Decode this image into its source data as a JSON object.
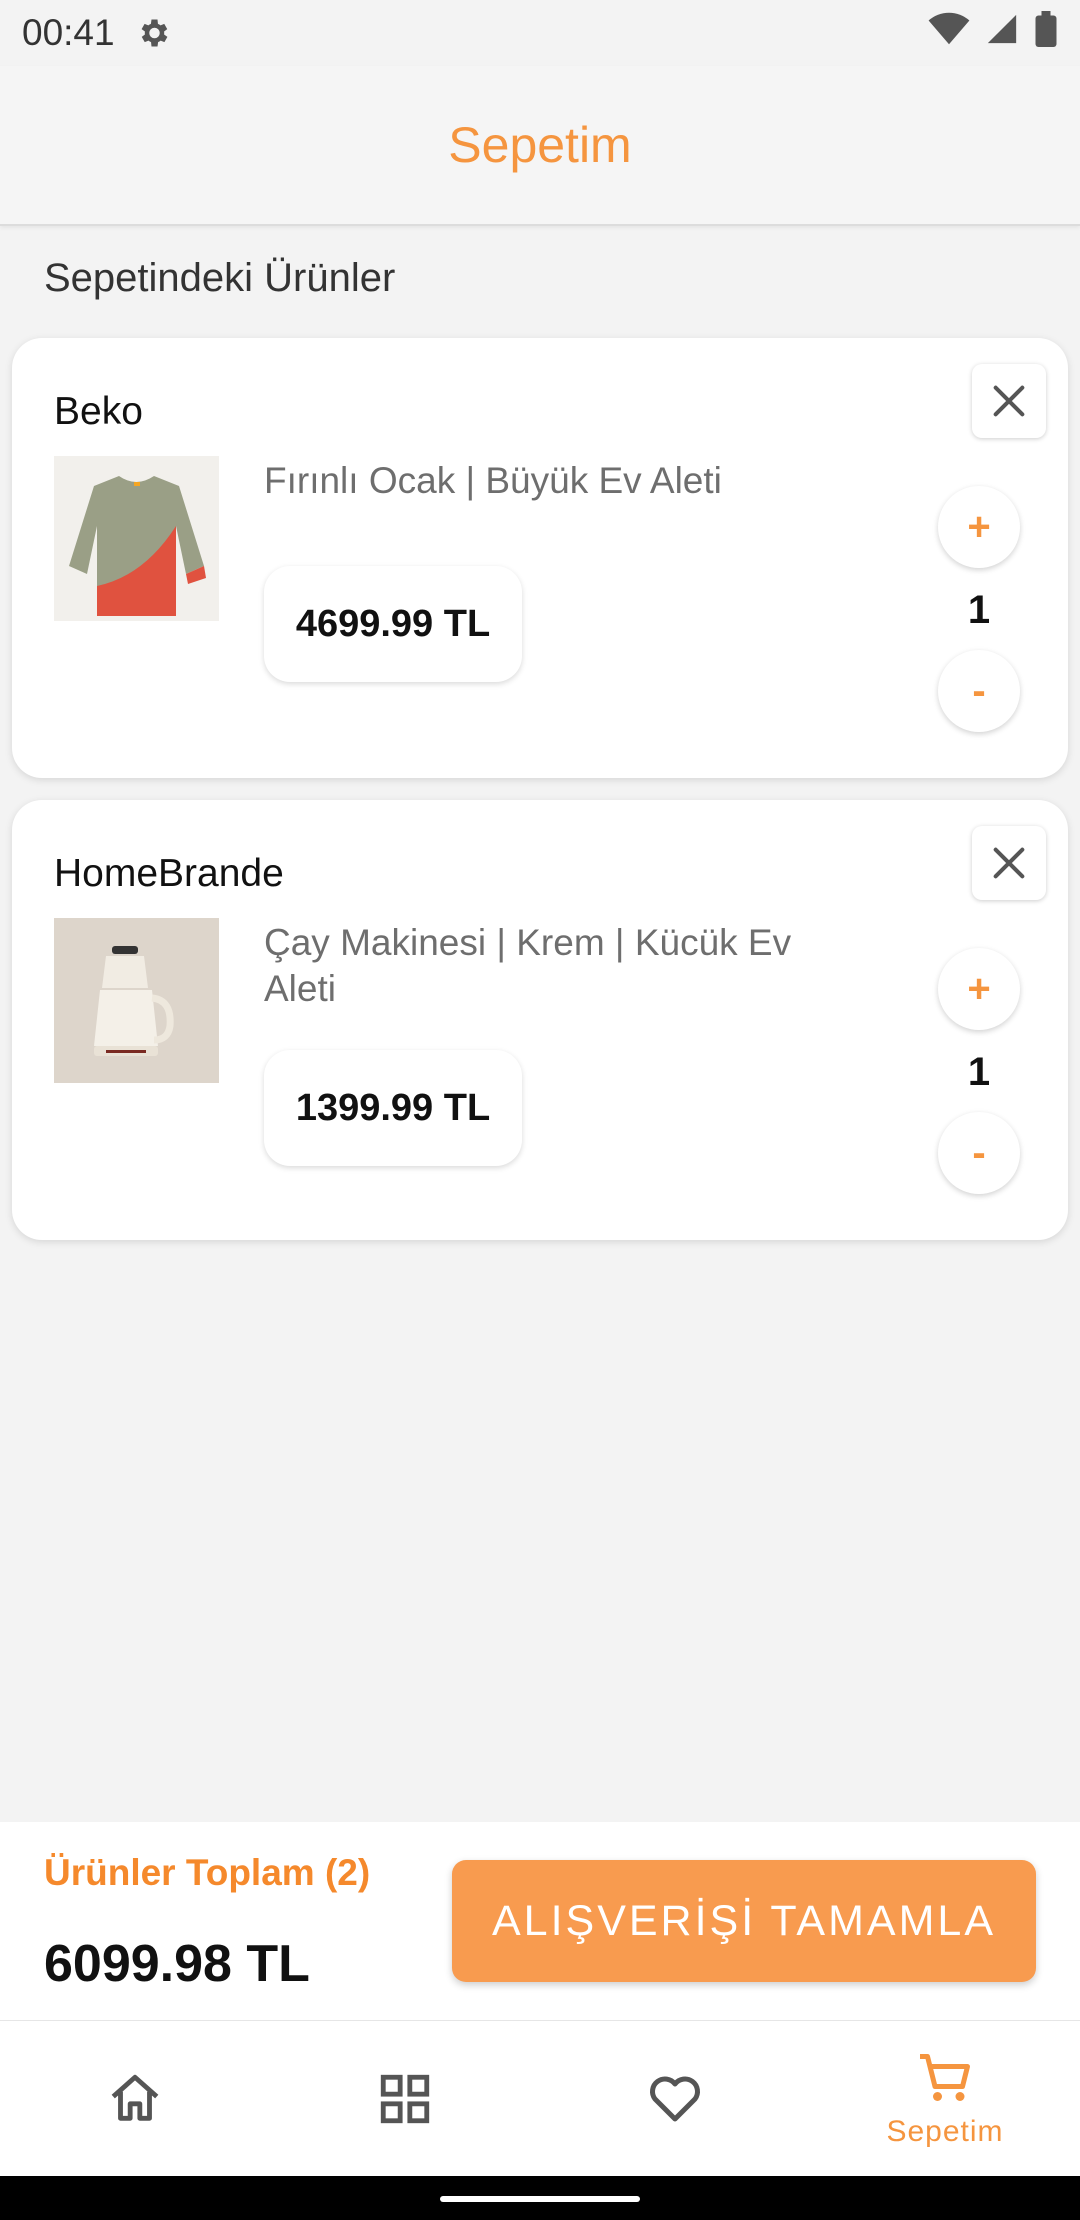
{
  "status_bar": {
    "time": "00:41",
    "icons": [
      "gear-icon",
      "wifi-icon",
      "signal-icon",
      "battery-icon"
    ]
  },
  "app_bar": {
    "title": "Sepetim"
  },
  "section": {
    "title": "Sepetindeki Ürünler"
  },
  "cart": {
    "items": [
      {
        "brand": "Beko",
        "name": "Fırınlı Ocak | Büyük  Ev Aleti",
        "price": "4699.99 TL",
        "quantity": "1",
        "plus": "+",
        "minus": "-"
      },
      {
        "brand": "HomeBrande",
        "name": "Çay Makinesi | Krem | Kücük Ev Aleti",
        "price": "1399.99 TL",
        "quantity": "1",
        "plus": "+",
        "minus": "-"
      }
    ]
  },
  "summary": {
    "label": "Ürünler Toplam (2)",
    "total": "6099.98 TL",
    "checkout_label": "ALIŞVERİŞİ TAMAMLA"
  },
  "bottom_nav": {
    "items": [
      {
        "icon": "home-icon",
        "label": ""
      },
      {
        "icon": "grid-icon",
        "label": ""
      },
      {
        "icon": "heart-icon",
        "label": ""
      },
      {
        "icon": "cart-icon",
        "label": "Sepetim",
        "active": true
      }
    ]
  },
  "colors": {
    "accent": "#f5953f",
    "button": "#f89b4f",
    "background": "#f3f3f3"
  }
}
